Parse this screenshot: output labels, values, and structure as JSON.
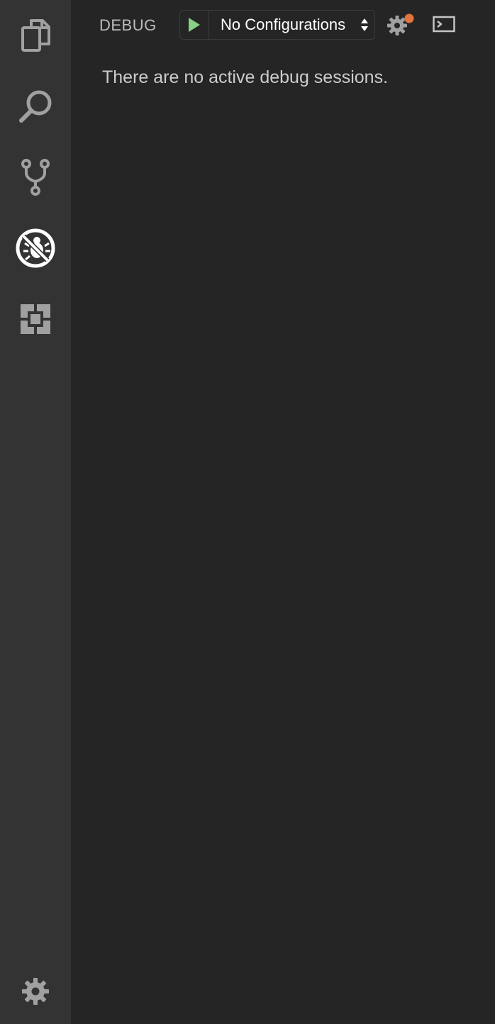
{
  "activity_bar": {
    "items": [
      {
        "icon": "files-icon",
        "active": false
      },
      {
        "icon": "search-icon",
        "active": false
      },
      {
        "icon": "source-control-icon",
        "active": false
      },
      {
        "icon": "debug-icon",
        "active": true
      },
      {
        "icon": "extensions-icon",
        "active": false
      }
    ],
    "manage_icon": "gear-icon"
  },
  "panel": {
    "title": "DEBUG",
    "configuration": {
      "selected": "No Configurations"
    },
    "empty_message": "There are no active debug sessions."
  },
  "colors": {
    "activity_bar_bg": "#333333",
    "panel_bg": "#252526",
    "icon_inactive": "#a0a0a0",
    "icon_active": "#ffffff",
    "start_green": "#89d185",
    "badge_orange": "#e2743c",
    "text": "#cccccc"
  }
}
